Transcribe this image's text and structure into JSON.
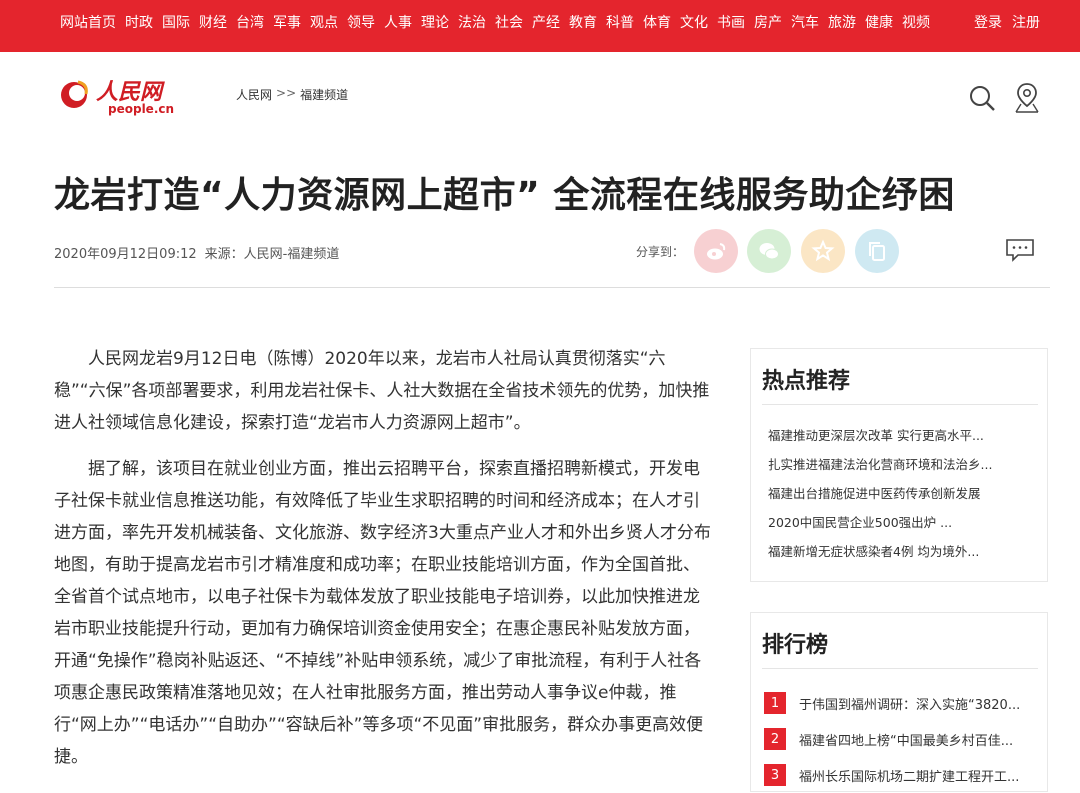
{
  "topnav": {
    "items": [
      "网站首页",
      "时政",
      "国际",
      "财经",
      "台湾",
      "军事",
      "观点",
      "领导",
      "人事",
      "理论",
      "法治",
      "社会",
      "产经",
      "教育",
      "科普",
      "体育",
      "文化",
      "书画",
      "房产",
      "汽车",
      "旅游",
      "健康",
      "视频"
    ],
    "login": "登录",
    "register": "注册"
  },
  "header": {
    "logo_cn": "人民网",
    "logo_en": "people.cn",
    "breadcrumb_home": "人民网",
    "breadcrumb_sep": ">>",
    "breadcrumb_channel": "福建频道"
  },
  "article": {
    "title": "龙岩打造“人力资源网上超市” 全流程在线服务助企纾困",
    "datetime": "2020年09月12日09:12",
    "source": "来源：人民网-福建频道",
    "share_label": "分享到：",
    "paragraphs": [
      "人民网龙岩9月12日电（陈博）2020年以来，龙岩市人社局认真贯彻落实“六稳”“六保”各项部署要求，利用龙岩社保卡、人社大数据在全省技术领先的优势，加快推进人社领域信息化建设，探索打造“龙岩市人力资源网上超市”。",
      "据了解，该项目在就业创业方面，推出云招聘平台，探索直播招聘新模式，开发电子社保卡就业信息推送功能，有效降低了毕业生求职招聘的时间和经济成本；在人才引进方面，率先开发机械装备、文化旅游、数字经济3大重点产业人才和外出乡贤人才分布地图，有助于提高龙岩市引才精准度和成功率；在职业技能培训方面，作为全国首批、全省首个试点地市，以电子社保卡为载体发放了职业技能电子培训券，以此加快推进龙岩市职业技能提升行动，更加有力确保培训资金使用安全；在惠企惠民补贴发放方面，开通“免操作”稳岗补贴返还、“不掉线”补贴申领系统，减少了审批流程，有利于人社各项惠企惠民政策精准落地见效；在人社审批服务方面，推出劳动人事争议e仲裁，推行“网上办”“电话办”“自助办”“容缺后补”等多项“不见面”审批服务，群众办事更高效便捷。"
    ]
  },
  "hot": {
    "title": "热点推荐",
    "items": [
      "福建推动更深层次改革 实行更高水平...",
      "扎实推进福建法治化营商环境和法治乡...",
      "福建出台措施促进中医药传承创新发展",
      "2020中国民营企业500强出炉 ...",
      "福建新增无症状感染者4例 均为境外..."
    ]
  },
  "rank": {
    "title": "排行榜",
    "items": [
      {
        "num": "1",
        "text": "于伟国到福州调研：深入实施“3820..."
      },
      {
        "num": "2",
        "text": "福建省四地上榜“中国最美乡村百佳..."
      },
      {
        "num": "3",
        "text": "福州长乐国际机场二期扩建工程开工..."
      }
    ]
  },
  "colors": {
    "brand_red": "#e4252d"
  }
}
